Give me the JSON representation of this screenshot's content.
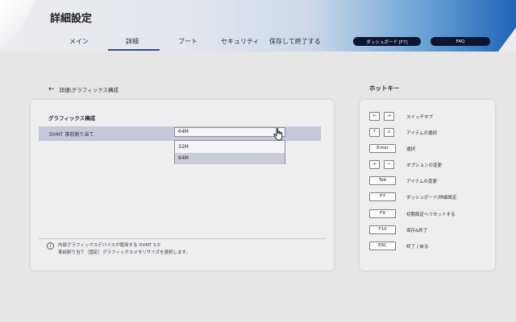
{
  "header": {
    "title": "詳細設定",
    "tabs": [
      {
        "label": "メイン"
      },
      {
        "label": "詳細"
      },
      {
        "label": "ブート"
      },
      {
        "label": "セキュリティ"
      },
      {
        "label": "保存して終了する"
      }
    ],
    "active_tab": "詳細",
    "dashboard_button": "ダッシュボード [F7]",
    "faq_button": "FAQ"
  },
  "breadcrumb": {
    "back_icon": "arrow-left-icon",
    "text": "詳細\\グラフィックス構成"
  },
  "main": {
    "section_title": "グラフィックス構成",
    "setting": {
      "label": "DVMT 事前割り当て",
      "value": "64M",
      "options": [
        "32M",
        "64M"
      ],
      "highlighted_option": "64M"
    },
    "info": {
      "icon": "info-icon",
      "line1": "内部グラフィックスデバイスが使用する DVMT 5.0",
      "line2": "事前割り当て（固定）グラフィックスメモリサイズを選択します。"
    }
  },
  "hotkeys": {
    "title": "ホットキー",
    "items": [
      {
        "keys": [
          "←",
          "→"
        ],
        "desc": "スイッチタブ"
      },
      {
        "keys": [
          "↑",
          "↓"
        ],
        "desc": "アイテムの選択"
      },
      {
        "keys": [
          "Enter"
        ],
        "desc": "選択"
      },
      {
        "keys": [
          "+",
          "−"
        ],
        "desc": "オプションの変更"
      },
      {
        "keys": [
          "Tab"
        ],
        "desc": "アイテムの変更"
      },
      {
        "keys": [
          "F7"
        ],
        "desc": "ダッシュボード/詳細設定"
      },
      {
        "keys": [
          "F9"
        ],
        "desc": "初期設定へリセットする"
      },
      {
        "keys": [
          "F10"
        ],
        "desc": "保存&終了"
      },
      {
        "keys": [
          "ESC"
        ],
        "desc": "終了 / 戻る"
      }
    ]
  },
  "colors": {
    "header_gradient_end": "#1f64b7",
    "header_button_bg": "#0d1530",
    "selected_row": "#c5c7da",
    "panel_bg": "#efeeef",
    "page_bg": "#e7e6e7"
  }
}
